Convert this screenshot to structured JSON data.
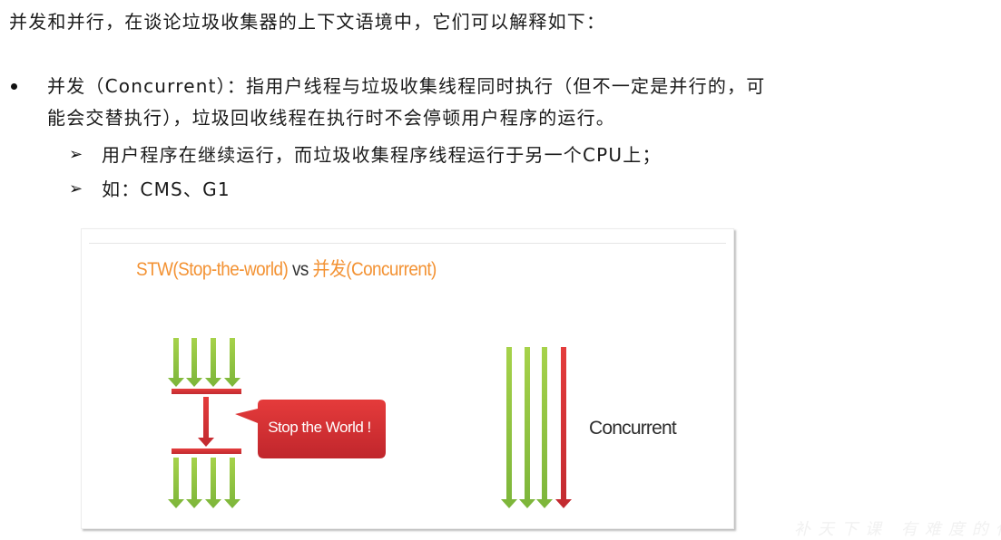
{
  "intro": "并发和并行，在谈论垃圾收集器的上下文语境中，它们可以解释如下：",
  "bullet": {
    "marker": "•",
    "line1": "并发（Concurrent）：指用户线程与垃圾收集线程同时执行（但不一定是并行的，可",
    "line2": "能会交替执行），垃圾回收线程在执行时不会停顿用户程序的运行。"
  },
  "sub_bullets": [
    {
      "marker": "➢",
      "text": "用户程序在继续运行，而垃圾收集程序线程运行于另一个CPU上；"
    },
    {
      "marker": "➢",
      "text": "如：CMS、G1"
    }
  ],
  "figure": {
    "title_part1": "STW(Stop-the-world)",
    "title_vs": " vs ",
    "title_part2": "并发(Concurrent)",
    "bubble_text": "Stop the World !",
    "concurrent_label": "Concurrent",
    "colors": {
      "title_accent": "#f39233",
      "thread_green": "#8cc43f",
      "pause_red": "#d8353a"
    },
    "stw_diagram": {
      "threads_before": 4,
      "threads_after": 4,
      "gc_threads": 1
    },
    "concurrent_diagram": {
      "user_threads": 3,
      "gc_threads": 1
    }
  },
  "watermark": "补天下课 有难度的代"
}
